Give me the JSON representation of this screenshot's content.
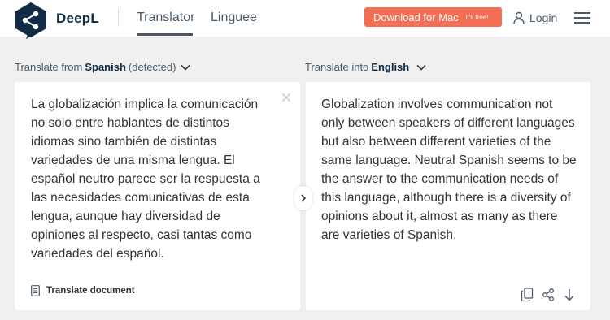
{
  "header": {
    "brand": "DeepL",
    "tabs": [
      {
        "label": "Translator",
        "active": true
      },
      {
        "label": "Linguee",
        "active": false
      }
    ],
    "download": {
      "label": "Download for Mac",
      "badge": "it's free!",
      "color": "#f26e55"
    },
    "login_label": "Login",
    "menu_icon": "hamburger-menu-icon"
  },
  "source": {
    "prefix": "Translate from",
    "language": "Spanish",
    "suffix": "(detected)",
    "text": "La globalización implica la comunicación no solo entre hablantes de distintos idiomas sino también de distintas variedades de una misma lengua. El español neutro parece ser la respuesta a las necesidades comunicativas de esta lengua, aunque hay diversidad de opiniones al respecto, casi tantas como variedades del español.",
    "clear_icon": "close-icon",
    "translate_document_label": "Translate document"
  },
  "target": {
    "prefix": "Translate into",
    "language": "English",
    "text": "Globalization involves communication not only between speakers of different languages but also between different varieties of the same language. Neutral Spanish seems to be the answer to the communication needs of this language, although there is a diversity of opinions about it, almost as many as there are varieties of Spanish.",
    "actions": [
      "copy-icon",
      "share-icon",
      "download-icon"
    ]
  },
  "colors": {
    "accent": "#f26e55",
    "brand_dark": "#0f2b46",
    "background": "#f0f0f0"
  }
}
